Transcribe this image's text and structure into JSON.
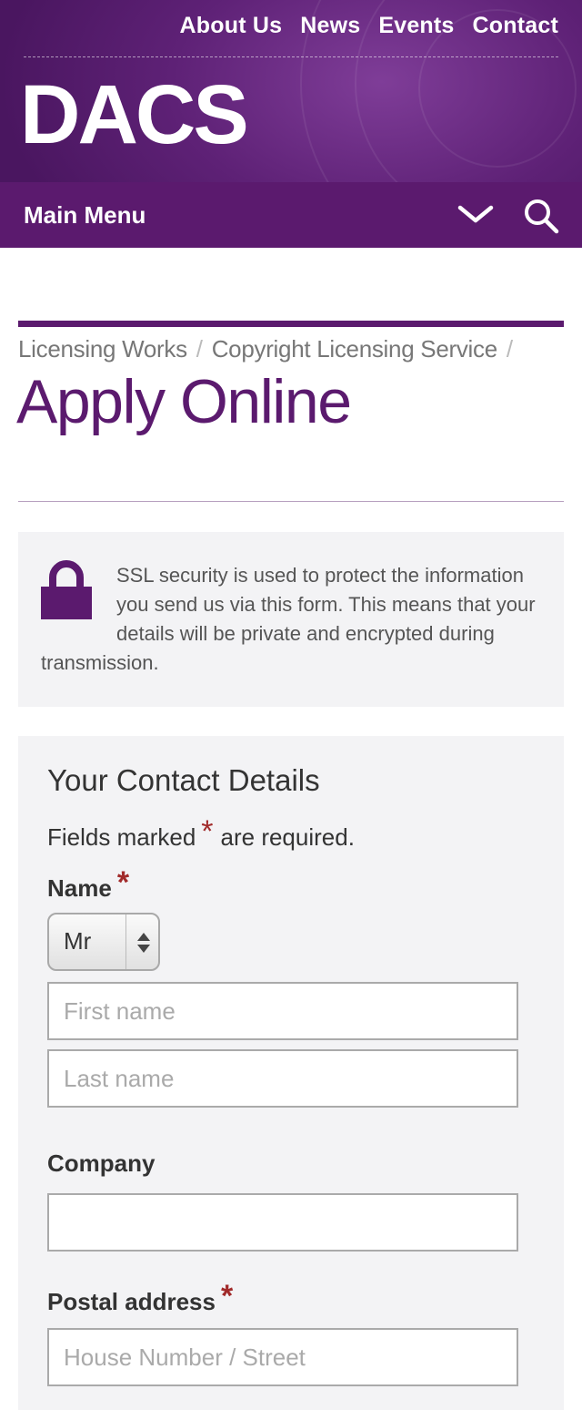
{
  "header": {
    "top_links": [
      "About Us",
      "News",
      "Events",
      "Contact"
    ],
    "logo": "DACS",
    "main_menu_label": "Main Menu"
  },
  "breadcrumb": {
    "items": [
      "Licensing Works",
      "Copyright Licensing Service"
    ],
    "separator": "/"
  },
  "page_title": "Apply Online",
  "ssl_notice": "SSL security is used to protect the information you send us via this form. This means that your details will be private and encrypted during transmission.",
  "form": {
    "heading": "Your Contact Details",
    "required_note_before": "Fields marked",
    "required_marker": "*",
    "required_note_after": "are required.",
    "name_label": "Name",
    "title_select_value": "Mr",
    "first_name_placeholder": "First name",
    "last_name_placeholder": "Last name",
    "company_label": "Company",
    "company_value": "",
    "postal_address_label": "Postal address",
    "street_placeholder": "House Number / Street"
  },
  "colors": {
    "brand_purple": "#5b1a6e",
    "required_red": "#a12a2a",
    "panel_bg": "#f3f3f5"
  },
  "icons": [
    "chevron-down-icon",
    "search-icon",
    "lock-icon",
    "select-arrows-icon"
  ]
}
